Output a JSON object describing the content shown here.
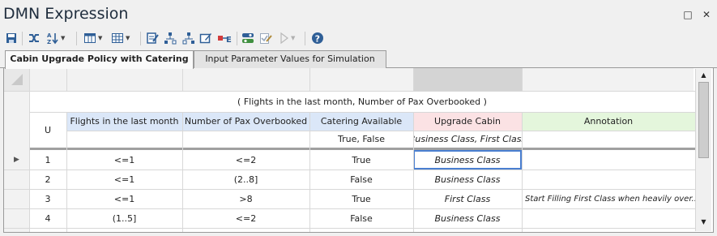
{
  "window": {
    "title": "DMN Expression",
    "controls": {
      "maximize_icon": "□",
      "close_icon": "✕"
    }
  },
  "toolbar": {
    "icons": [
      "save-icon",
      "shuffle-icon",
      "sort-az-icon",
      "columns-icon",
      "grid-icon",
      "validate-icon",
      "tree-left-icon",
      "tree-right-icon",
      "edit-table-icon",
      "input-output-icon",
      "simulate-icon",
      "edit-check-icon",
      "run-icon",
      "help-icon"
    ]
  },
  "tabs": [
    {
      "label": "Cabin Upgrade Policy with Catering",
      "active": true
    },
    {
      "label": "Input Parameter Values for Simulation",
      "active": false
    }
  ],
  "decision_table": {
    "input_expression": "( Flights in the last month, Number of Pax Overbooked )",
    "hit_policy": "U",
    "columns": [
      {
        "label": "Flights in the last month",
        "kind": "input",
        "allowed_values": ""
      },
      {
        "label": "Number of Pax Overbooked",
        "kind": "input",
        "allowed_values": ""
      },
      {
        "label": "Catering Available",
        "kind": "input",
        "allowed_values": "True, False"
      },
      {
        "label": "Upgrade Cabin",
        "kind": "output",
        "allowed_values": "Business Class, First Class"
      },
      {
        "label": "Annotation",
        "kind": "annotation",
        "allowed_values": ""
      }
    ],
    "rows": [
      {
        "num": "1",
        "flights": "<=1",
        "pax": "<=2",
        "catering": "True",
        "upgrade": "Business Class",
        "annotation": ""
      },
      {
        "num": "2",
        "flights": "<=1",
        "pax": "(2..8]",
        "catering": "False",
        "upgrade": "Business Class",
        "annotation": ""
      },
      {
        "num": "3",
        "flights": "<=1",
        "pax": ">8",
        "catering": "True",
        "upgrade": "First Class",
        "annotation": "Start Filling First Class when heavily over..."
      },
      {
        "num": "4",
        "flights": "(1..5]",
        "pax": "<=2",
        "catering": "False",
        "upgrade": "Business Class",
        "annotation": ""
      }
    ]
  },
  "colors": {
    "input_header": "#dbe7f8",
    "output_header": "#fbe2e4",
    "annotation_header": "#e4f6dc",
    "selected_column_header": "#d4d4d4",
    "selected_cell_border": "#4a7fd0"
  }
}
